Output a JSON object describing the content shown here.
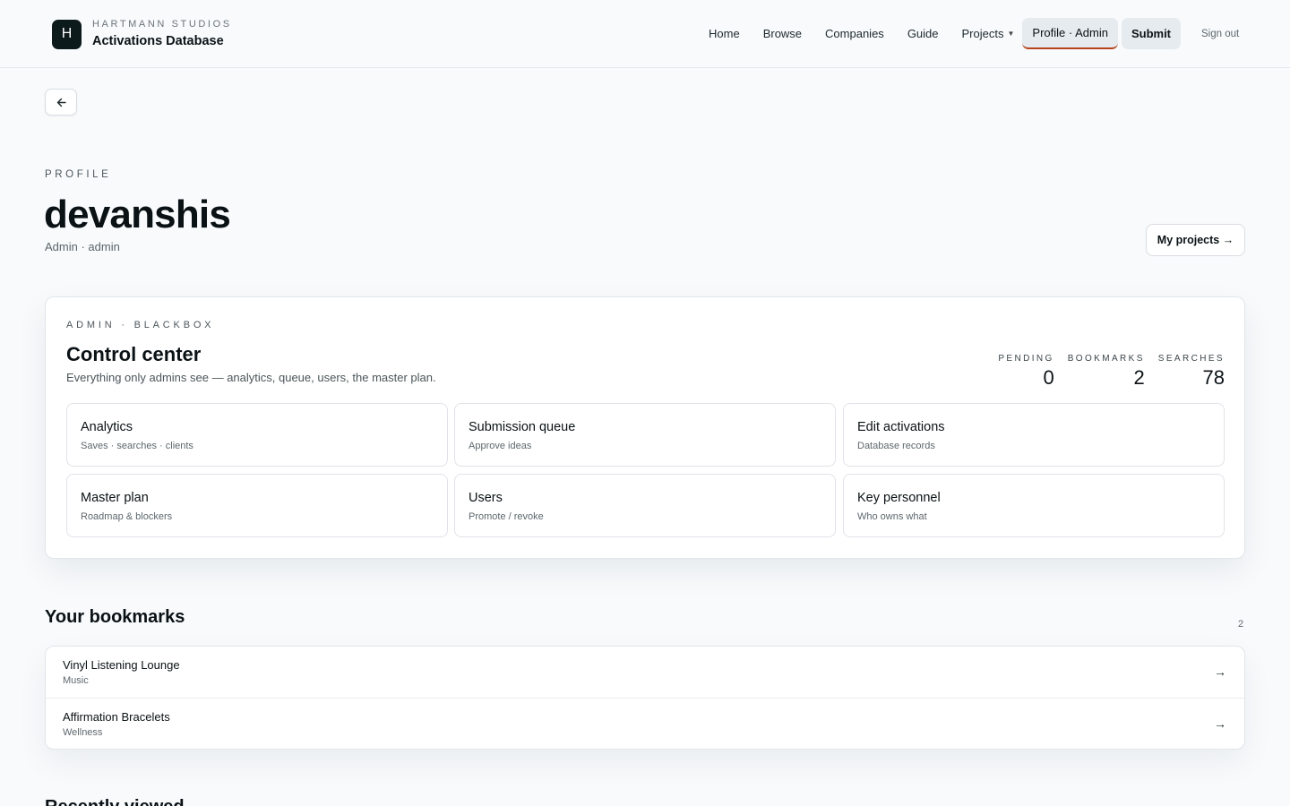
{
  "header": {
    "brand_mark": "H",
    "brand_sub": "HARTMANN STUDIOS",
    "brand_name": "Activations Database",
    "nav": {
      "home": "Home",
      "browse": "Browse",
      "companies": "Companies",
      "guide": "Guide",
      "projects": "Projects",
      "profile": "Profile · Admin",
      "submit": "Submit",
      "signout": "Sign out"
    }
  },
  "profile": {
    "eyebrow": "PROFILE",
    "username": "devanshis",
    "role_line": "Admin · admin",
    "my_projects_label": "My projects →"
  },
  "admin": {
    "eyebrow": "ADMIN · BLACKBOX",
    "title": "Control center",
    "description": "Everything only admins see — analytics, queue, users, the master plan.",
    "stats": [
      {
        "label": "PENDING",
        "value": "0"
      },
      {
        "label": "BOOKMARKS",
        "value": "2"
      },
      {
        "label": "SEARCHES",
        "value": "78"
      }
    ],
    "tiles": [
      {
        "title": "Analytics",
        "subtitle": "Saves · searches · clients"
      },
      {
        "title": "Submission queue",
        "subtitle": "Approve ideas"
      },
      {
        "title": "Edit activations",
        "subtitle": "Database records"
      },
      {
        "title": "Master plan",
        "subtitle": "Roadmap & blockers"
      },
      {
        "title": "Users",
        "subtitle": "Promote / revoke"
      },
      {
        "title": "Key personnel",
        "subtitle": "Who owns what"
      }
    ]
  },
  "bookmarks": {
    "title": "Your bookmarks",
    "count": "2",
    "items": [
      {
        "name": "Vinyl Listening Lounge",
        "category": "Music"
      },
      {
        "name": "Affirmation Bracelets",
        "category": "Wellness"
      }
    ]
  },
  "next_section": {
    "title": "Recently viewed"
  },
  "icons": {
    "back": "arrow-left-icon",
    "row_arrow": "arrow-right-icon",
    "caret": "caret-down-icon"
  },
  "colors": {
    "accent": "#b5431b",
    "brand_dark": "#0d1a1c",
    "pill_bg": "#e6ebef"
  }
}
